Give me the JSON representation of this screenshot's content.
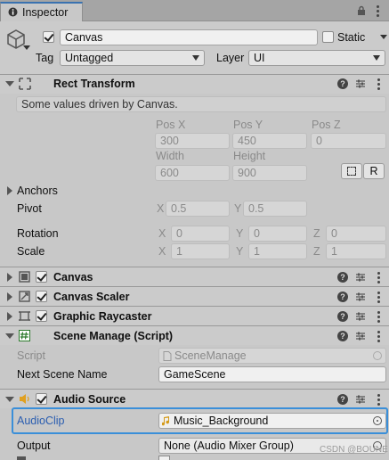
{
  "tab": {
    "label": "Inspector"
  },
  "header": {
    "object_name": "Canvas",
    "static_label": "Static",
    "tag_label": "Tag",
    "tag_value": "Untagged",
    "layer_label": "Layer",
    "layer_value": "UI"
  },
  "rect_transform": {
    "title": "Rect Transform",
    "driven_note": "Some values driven by Canvas.",
    "pos_x_label": "Pos X",
    "pos_x": "300",
    "pos_y_label": "Pos Y",
    "pos_y": "450",
    "pos_z_label": "Pos Z",
    "pos_z": "0",
    "width_label": "Width",
    "width": "600",
    "height_label": "Height",
    "height": "900",
    "r_button": "R",
    "anchors_label": "Anchors",
    "pivot_label": "Pivot",
    "pivot_x": "0.5",
    "pivot_y": "0.5",
    "rotation_label": "Rotation",
    "rot_x": "0",
    "rot_y": "0",
    "rot_z": "0",
    "scale_label": "Scale",
    "scale_x": "1",
    "scale_y": "1",
    "scale_z": "1",
    "axis_x": "X",
    "axis_y": "Y",
    "axis_z": "Z"
  },
  "components": {
    "canvas": "Canvas",
    "canvas_scaler": "Canvas Scaler",
    "graphic_raycaster": "Graphic Raycaster",
    "scene_manage": "Scene Manage (Script)",
    "audio_source": "Audio Source"
  },
  "scene_manage": {
    "script_label": "Script",
    "script_value": "SceneManage",
    "next_scene_label": "Next Scene Name",
    "next_scene_value": "GameScene"
  },
  "audio_source": {
    "clip_label": "AudioClip",
    "clip_value": "Music_Background",
    "output_label": "Output",
    "output_value": "None (Audio Mixer Group)"
  },
  "watermark": "CSDN @BOUNE",
  "colors": {
    "accent": "#3a8fd9",
    "background": "#c8c8c8"
  }
}
